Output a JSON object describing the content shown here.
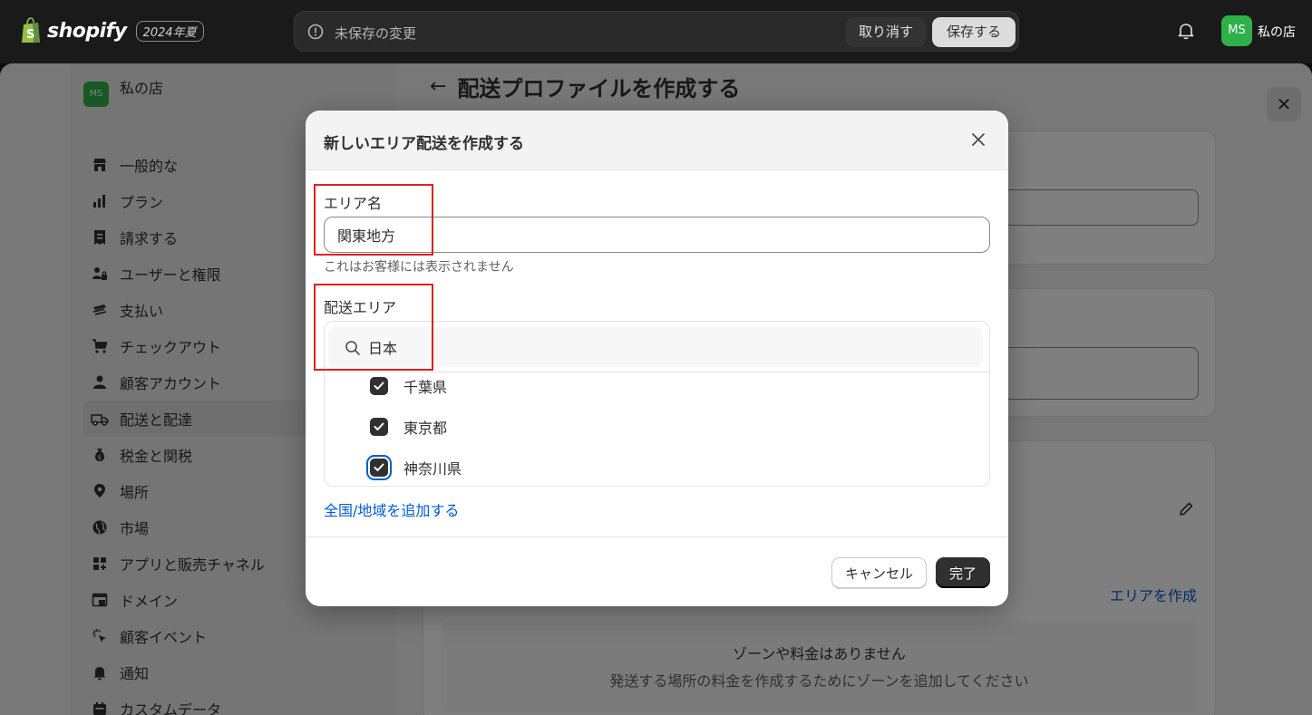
{
  "topbar": {
    "brand": "shopify",
    "edition": "2024年夏",
    "unsaved_message": "未保存の変更",
    "discard_label": "取り消す",
    "save_label": "保存する",
    "avatar_initials": "MS",
    "store_name": "私の店"
  },
  "sidebar": {
    "avatar_initials": "MS",
    "store_name": "私の店",
    "items": [
      {
        "label": "一般的な",
        "icon": "store-icon"
      },
      {
        "label": "プラン",
        "icon": "plan-icon"
      },
      {
        "label": "請求する",
        "icon": "receipt-icon"
      },
      {
        "label": "ユーザーと権限",
        "icon": "users-lock-icon"
      },
      {
        "label": "支払い",
        "icon": "payments-icon"
      },
      {
        "label": "チェックアウト",
        "icon": "cart-icon"
      },
      {
        "label": "顧客アカウント",
        "icon": "person-icon"
      },
      {
        "label": "配送と配達",
        "icon": "truck-icon",
        "active": true
      },
      {
        "label": "税金と関税",
        "icon": "money-bag-icon"
      },
      {
        "label": "場所",
        "icon": "location-pin-icon"
      },
      {
        "label": "市場",
        "icon": "globe-icon"
      },
      {
        "label": "アプリと販売チャネル",
        "icon": "apps-icon"
      },
      {
        "label": "ドメイン",
        "icon": "domain-icon"
      },
      {
        "label": "顧客イベント",
        "icon": "cursor-click-icon"
      },
      {
        "label": "通知",
        "icon": "bell-icon"
      },
      {
        "label": "カスタムデータ",
        "icon": "database-icon"
      }
    ]
  },
  "page": {
    "back_arrow": "←",
    "title": "配送プロファイルを作成する",
    "create_area_link": "エリアを作成",
    "empty_title": "ゾーンや料金はありません",
    "empty_subtitle": "発送する場所の料金を作成するためにゾーンを追加してください"
  },
  "modal": {
    "title": "新しいエリア配送を作成する",
    "area_name_label": "エリア名",
    "area_name_value": "関東地方",
    "area_name_help": "これはお客様には表示されません",
    "shipping_area_label": "配送エリア",
    "search_value": "日本",
    "regions": [
      {
        "label": "千葉県",
        "checked": true
      },
      {
        "label": "東京都",
        "checked": true
      },
      {
        "label": "神奈川県",
        "checked": true,
        "focused": true
      }
    ],
    "add_country_link": "全国/地域を追加する",
    "cancel_label": "キャンセル",
    "done_label": "完了"
  },
  "colors": {
    "brand_green": "#2fb14a",
    "link_blue": "#005bd3",
    "highlight_red": "#e02020"
  }
}
